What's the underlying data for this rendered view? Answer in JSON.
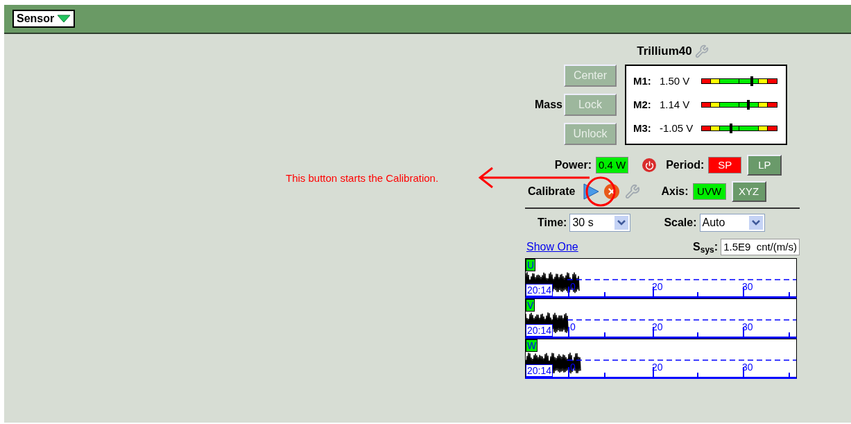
{
  "header": {
    "menu": {
      "label": "Sensor"
    }
  },
  "annotation": {
    "text": "This button starts the Calibration."
  },
  "sensor": {
    "title": "Trillium40",
    "mass": {
      "label": "Mass",
      "buttons": [
        {
          "label": "Center",
          "disabled": true
        },
        {
          "label": "Lock",
          "disabled": true
        },
        {
          "label": "Unlock",
          "disabled": true
        }
      ]
    },
    "meters": [
      {
        "label": "M1:",
        "reading": "1.50 V",
        "level": 0.67
      },
      {
        "label": "M2:",
        "reading": "1.14 V",
        "level": 0.62
      },
      {
        "label": "M3:",
        "reading": "-1.05 V",
        "level": 0.39
      }
    ],
    "power": {
      "label": "Power:",
      "value": "0.4 W"
    },
    "period": {
      "label": "Period:",
      "options": [
        {
          "label": "SP",
          "selected": true
        },
        {
          "label": "LP",
          "selected": false
        }
      ]
    },
    "calibrate": {
      "label": "Calibrate"
    },
    "axis": {
      "label": "Axis:",
      "options": [
        {
          "label": "UVW",
          "selected": true
        },
        {
          "label": "XYZ",
          "selected": false
        }
      ]
    },
    "time": {
      "label": "Time:",
      "value": "30 s"
    },
    "scale": {
      "label": "Scale:",
      "value": "Auto"
    },
    "show_one": "Show One",
    "ssys": {
      "label": "S$_{sys}$:",
      "value": "1.5E9  cnt/(m/s)"
    },
    "traces": [
      {
        "channel": "U",
        "time": "20:14",
        "ticks": [
          "0",
          "20",
          "30"
        ]
      },
      {
        "channel": "V",
        "time": "20:14",
        "ticks": [
          "0",
          "20",
          "30"
        ]
      },
      {
        "channel": "W",
        "time": "20:14",
        "ticks": [
          "0",
          "20",
          "30"
        ]
      }
    ]
  }
}
